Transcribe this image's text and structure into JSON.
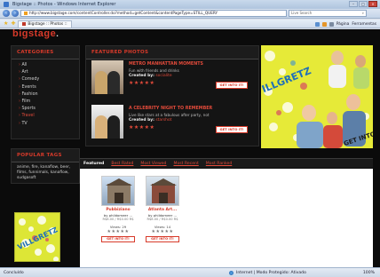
{
  "window": {
    "title": "Bigstage :: Photos - Windows Internet Explorer"
  },
  "address": {
    "url": "http://www.bigstage.com/contentController.do?method=getContent&contentPageType=STILL_QUERY",
    "search_placeholder": "Live Search"
  },
  "tabs": [
    {
      "label": "Bigstage :: Photos ::"
    }
  ],
  "commands": {
    "page": "Página",
    "tools": "Ferramentas"
  },
  "site": {
    "logo": "bigstage",
    "logo_suffix": ".",
    "categories_heading": "Categories",
    "categories": [
      "All",
      "Art",
      "Comedy",
      "Events",
      "Fashion",
      "Film",
      "Sports",
      "Travel",
      "TV"
    ],
    "active_category": 7,
    "tags_heading": "Popular Tags",
    "tags_text": "anime, fire, kanaflow, beer, films, funnimals, kanaflow, sudgasoft",
    "featured_heading": "Featured Photos",
    "featured": [
      {
        "title": "METRO MANHATTAN MOMENTS",
        "subtitle": "Fun with friends and drinks",
        "created_by_label": "Created by:",
        "user": "socialite",
        "stars": "★★★★★",
        "button": "GET INTO IT!"
      },
      {
        "title": "A CELEBRITY NIGHT TO REMEMBER",
        "subtitle": "Live like stars at a fabulous after party, not",
        "created_by_label": "Created by:",
        "user": "starshot",
        "stars": "★★★★★",
        "button": "GET INTO IT!"
      }
    ],
    "banner": {
      "brand": "VILLGRETZ",
      "slogan": "GET INTO IT!"
    },
    "filters": [
      "Featured",
      "Best Rated",
      "Most Viewed",
      "Most Recent",
      "Most Ranked"
    ],
    "active_filter": 0,
    "cards": [
      {
        "title": "Pubbiziano",
        "by": "by phildomeer ...",
        "price": "R$8.00 / R$0.00 R$",
        "views": "Views: 29",
        "stars": "★★★★★",
        "button": "GET INTO IT!"
      },
      {
        "title": "Atlanta Art...",
        "by": "by phildomeer ...",
        "price": "R$8.00 / R$0.00 R$",
        "views": "Views: 14",
        "stars": "★★★★★",
        "button": "GET INTO IT!"
      }
    ]
  },
  "status": {
    "left": "Concluído",
    "zone": "Internet | Modo Protegido: Ativado",
    "zoom": "100%"
  }
}
